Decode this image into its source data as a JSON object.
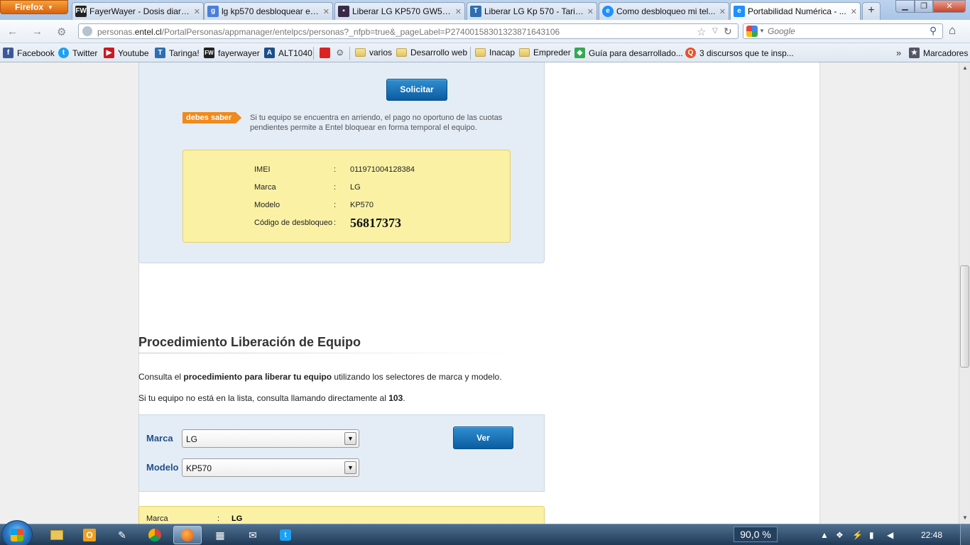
{
  "browser": {
    "menu_label": "Firefox",
    "tabs": [
      {
        "label": "FayerWayer - Dosis diaria...",
        "icon": "FW",
        "color": "#222222"
      },
      {
        "label": "lg kp570 desbloquear ent...",
        "icon": "g",
        "color": "#4a7fd9"
      },
      {
        "label": "Liberar LG KP570 GW525 ...",
        "icon": "▪",
        "color": "#3a2a4a"
      },
      {
        "label": "Liberar LG Kp 570 - Tarin...",
        "icon": "T",
        "color": "#2d6fb0"
      },
      {
        "label": "Como desbloqueo mi tel...",
        "icon": "e",
        "color": "#1e90ff"
      },
      {
        "label": "Portabilidad Numérica - ...",
        "icon": "e",
        "color": "#1e90ff"
      }
    ],
    "new_tab": "+",
    "url_prefix": "personas.",
    "url_host": "entel.cl",
    "url_path": "/PortalPersonas/appmanager/entelpcs/personas?_nfpb=true&_pageLabel=P27400158301323871643106",
    "search_placeholder": "Google",
    "bookmarks": [
      {
        "label": "Facebook",
        "icon": "f",
        "color": "#3b5998"
      },
      {
        "label": "Twitter",
        "icon": "t",
        "color": "#1da1f2"
      },
      {
        "label": "Youtube",
        "icon": "▶",
        "color": "#cc181e"
      },
      {
        "label": "Taringa!",
        "icon": "T",
        "color": "#2d6fb0"
      },
      {
        "label": "fayerwayer",
        "icon": "FW",
        "color": "#222222"
      },
      {
        "label": "ALT1040",
        "icon": "A",
        "color": "#1b4f8a"
      },
      {
        "label": "varios",
        "icon": "folder"
      },
      {
        "label": "Desarrollo web",
        "icon": "folder"
      },
      {
        "label": "Inacap",
        "icon": "folder"
      },
      {
        "label": "Empreder",
        "icon": "folder"
      },
      {
        "label": "Guía para desarrollado...",
        "icon": "◆",
        "color": "#34a853"
      },
      {
        "label": "3 discursos que te insp...",
        "icon": "Q",
        "color": "#e8512a"
      }
    ],
    "bookmarks_menu": "Marcadores",
    "overflow": "»"
  },
  "unlock": {
    "request_button": "Solicitar",
    "notice_badge": "debes saber",
    "notice_text": "Si tu equipo se encuentra en arriendo, el pago no oportuno de las cuotas pendientes permite a Entel bloquear en forma temporal el equipo.",
    "rows": [
      {
        "label": "IMEI",
        "value": "011971004128384"
      },
      {
        "label": "Marca",
        "value": "LG"
      },
      {
        "label": "Modelo",
        "value": "KP570"
      },
      {
        "label": "Código de desbloqueo",
        "value": "56817373"
      }
    ],
    "colon": ":"
  },
  "procedure": {
    "title": "Procedimiento Liberación de Equipo",
    "para1_pre": "Consulta el ",
    "para1_bold": "procedimiento para liberar tu equipo",
    "para1_post": " utilizando los selectores de marca y modelo.",
    "para2_pre": "Si tu equipo no está en la lista, consulta llamando directamente al ",
    "para2_bold": "103",
    "para2_post": ".",
    "brand_label": "Marca",
    "brand_value": "LG",
    "model_label": "Modelo",
    "model_value": "KP570",
    "view_button": "Ver",
    "result_brand_label": "Marca",
    "result_brand_value": "LG"
  },
  "taskbar": {
    "zoom": "90,0 %",
    "time": "22:48"
  }
}
